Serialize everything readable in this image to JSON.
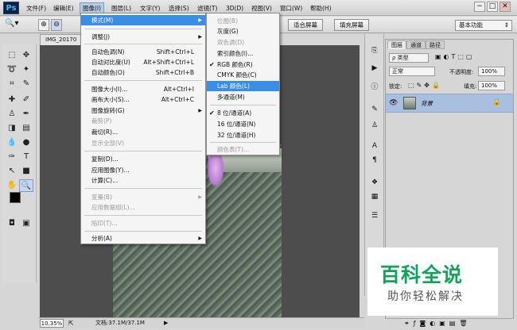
{
  "app": {
    "logo": "Ps"
  },
  "menubar": {
    "items": [
      "文件(F)",
      "编辑(E)",
      "图像(I)",
      "图层(L)",
      "文字(Y)",
      "选择(S)",
      "滤镜(T)",
      "3D(D)",
      "视图(V)",
      "窗口(W)",
      "帮助(H)"
    ],
    "active_index": 2,
    "window_buttons": [
      "−",
      "□",
      "✕"
    ]
  },
  "options_bar": {
    "fit_screen": "适合屏幕",
    "fill_screen": "填充屏幕",
    "workspace": "基本功能"
  },
  "document": {
    "tab_title": "IMG_20170",
    "zoom": "10.35%",
    "doc_info": "文档:37.1M/37.1M"
  },
  "image_menu": {
    "items": [
      {
        "label": "模式(M)",
        "shortcut": "",
        "submenu": true,
        "disabled": false,
        "open": true
      },
      {
        "sep": true
      },
      {
        "label": "调整(J)",
        "shortcut": "",
        "submenu": true,
        "disabled": false
      },
      {
        "sep": true
      },
      {
        "label": "自动色调(N)",
        "shortcut": "Shift+Ctrl+L"
      },
      {
        "label": "自动对比度(U)",
        "shortcut": "Alt+Shift+Ctrl+L"
      },
      {
        "label": "自动颜色(O)",
        "shortcut": "Shift+Ctrl+B"
      },
      {
        "sep": true
      },
      {
        "label": "图像大小(I)...",
        "shortcut": "Alt+Ctrl+I"
      },
      {
        "label": "画布大小(S)...",
        "shortcut": "Alt+Ctrl+C"
      },
      {
        "label": "图像旋转(G)",
        "shortcut": "",
        "submenu": true
      },
      {
        "label": "裁剪(P)",
        "shortcut": "",
        "disabled": true
      },
      {
        "label": "裁切(R)...",
        "shortcut": ""
      },
      {
        "label": "显示全部(V)",
        "shortcut": "",
        "disabled": true
      },
      {
        "sep": true
      },
      {
        "label": "复制(D)...",
        "shortcut": ""
      },
      {
        "label": "应用图像(Y)...",
        "shortcut": ""
      },
      {
        "label": "计算(C)...",
        "shortcut": ""
      },
      {
        "sep": true
      },
      {
        "label": "变量(B)",
        "shortcut": "",
        "submenu": true,
        "disabled": true
      },
      {
        "label": "应用数据组(L)...",
        "shortcut": "",
        "disabled": true
      },
      {
        "sep": true
      },
      {
        "label": "陷印(T)...",
        "shortcut": "",
        "disabled": true
      },
      {
        "sep": true
      },
      {
        "label": "分析(A)",
        "shortcut": "",
        "submenu": true
      }
    ]
  },
  "mode_submenu": {
    "items": [
      {
        "label": "位图(B)",
        "disabled": true
      },
      {
        "label": "灰度(G)"
      },
      {
        "label": "双色调(D)",
        "disabled": true
      },
      {
        "label": "索引颜色(I)..."
      },
      {
        "label": "RGB 颜色(R)",
        "checked": true
      },
      {
        "label": "CMYK 颜色(C)"
      },
      {
        "label": "Lab 颜色(L)",
        "highlighted": true
      },
      {
        "label": "多通道(M)"
      },
      {
        "sep": true
      },
      {
        "label": "8 位/通道(A)",
        "checked": true
      },
      {
        "label": "16 位/通道(N)"
      },
      {
        "label": "32 位/通道(H)"
      },
      {
        "sep": true
      },
      {
        "label": "颜色表(T)...",
        "disabled": true
      }
    ]
  },
  "layers_panel": {
    "tabs": [
      "图层",
      "通道",
      "路径"
    ],
    "kind_filter": "ρ 类型",
    "blend_mode": "正常",
    "opacity_label": "不透明度:",
    "opacity": "100%",
    "lock_label": "锁定:",
    "fill_label": "填充:",
    "fill": "100%",
    "layer_name": "背景"
  },
  "watermark": {
    "title": "百科全说",
    "subtitle": "助你轻松解决"
  },
  "colors": {
    "highlight": "#3a8ee6",
    "layer_selected": "#a9bfe0",
    "watermark_green": "#12a35a"
  }
}
